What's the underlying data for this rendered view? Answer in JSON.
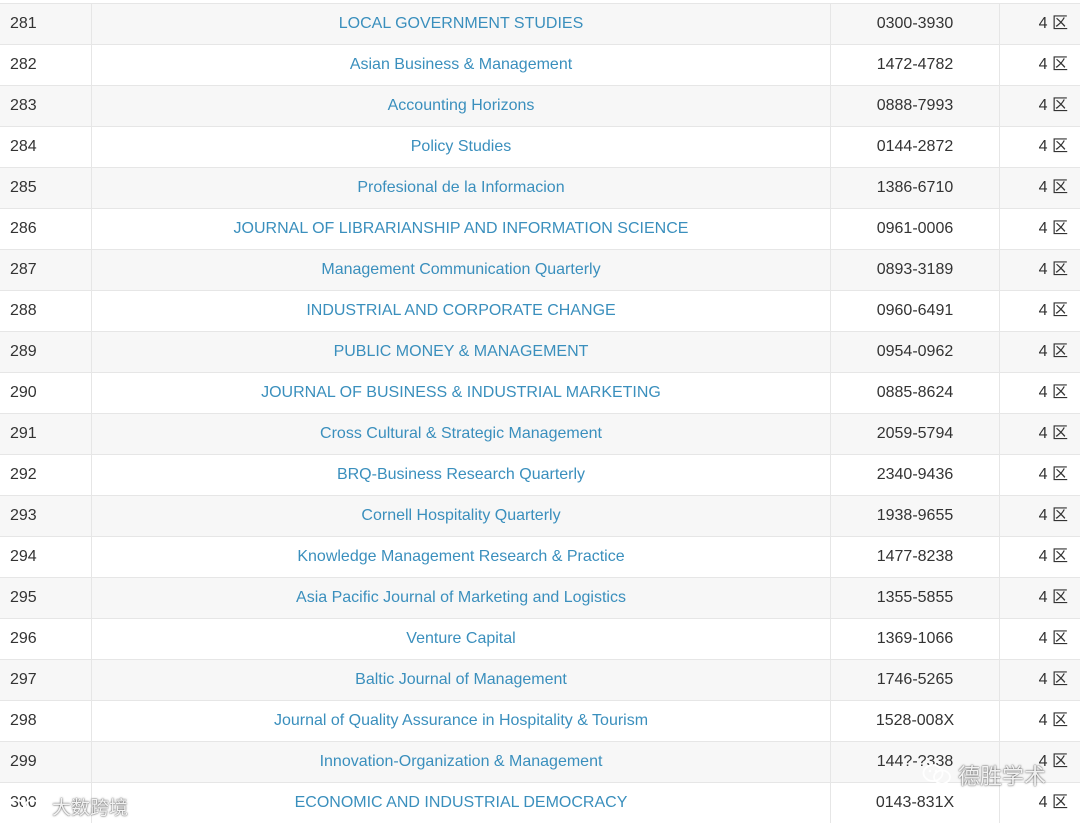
{
  "rows": [
    {
      "rank": "281",
      "title": "LOCAL GOVERNMENT STUDIES",
      "issn": "0300-3930",
      "zone": "4 区"
    },
    {
      "rank": "282",
      "title": "Asian Business & Management",
      "issn": "1472-4782",
      "zone": "4 区"
    },
    {
      "rank": "283",
      "title": "Accounting Horizons",
      "issn": "0888-7993",
      "zone": "4 区"
    },
    {
      "rank": "284",
      "title": "Policy Studies",
      "issn": "0144-2872",
      "zone": "4 区"
    },
    {
      "rank": "285",
      "title": "Profesional de la Informacion",
      "issn": "1386-6710",
      "zone": "4 区"
    },
    {
      "rank": "286",
      "title": "JOURNAL OF LIBRARIANSHIP AND INFORMATION SCIENCE",
      "issn": "0961-0006",
      "zone": "4 区"
    },
    {
      "rank": "287",
      "title": "Management Communication Quarterly",
      "issn": "0893-3189",
      "zone": "4 区"
    },
    {
      "rank": "288",
      "title": "INDUSTRIAL AND CORPORATE CHANGE",
      "issn": "0960-6491",
      "zone": "4 区"
    },
    {
      "rank": "289",
      "title": "PUBLIC MONEY & MANAGEMENT",
      "issn": "0954-0962",
      "zone": "4 区"
    },
    {
      "rank": "290",
      "title": "JOURNAL OF BUSINESS & INDUSTRIAL MARKETING",
      "issn": "0885-8624",
      "zone": "4 区"
    },
    {
      "rank": "291",
      "title": "Cross Cultural & Strategic Management",
      "issn": "2059-5794",
      "zone": "4 区"
    },
    {
      "rank": "292",
      "title": "BRQ-Business Research Quarterly",
      "issn": "2340-9436",
      "zone": "4 区"
    },
    {
      "rank": "293",
      "title": "Cornell Hospitality Quarterly",
      "issn": "1938-9655",
      "zone": "4 区"
    },
    {
      "rank": "294",
      "title": "Knowledge Management Research & Practice",
      "issn": "1477-8238",
      "zone": "4 区"
    },
    {
      "rank": "295",
      "title": "Asia Pacific Journal of Marketing and Logistics",
      "issn": "1355-5855",
      "zone": "4 区"
    },
    {
      "rank": "296",
      "title": "Venture Capital",
      "issn": "1369-1066",
      "zone": "4 区"
    },
    {
      "rank": "297",
      "title": "Baltic Journal of Management",
      "issn": "1746-5265",
      "zone": "4 区"
    },
    {
      "rank": "298",
      "title": "Journal of Quality Assurance in Hospitality & Tourism",
      "issn": "1528-008X",
      "zone": "4 区"
    },
    {
      "rank": "299",
      "title": "Innovation-Organization & Management",
      "issn": "144?-?338",
      "zone": "4 区"
    },
    {
      "rank": "300",
      "title": "ECONOMIC AND INDUSTRIAL DEMOCRACY",
      "issn": "0143-831X",
      "zone": "4 区"
    }
  ],
  "watermarks": {
    "right_text": "德胜学术",
    "left_text": "大数跨境",
    "icon": "wechat-icon"
  },
  "colors": {
    "link": "#3a8fbd",
    "text": "#333333",
    "stripe": "#f7f7f7",
    "border": "#e6e6e6"
  }
}
